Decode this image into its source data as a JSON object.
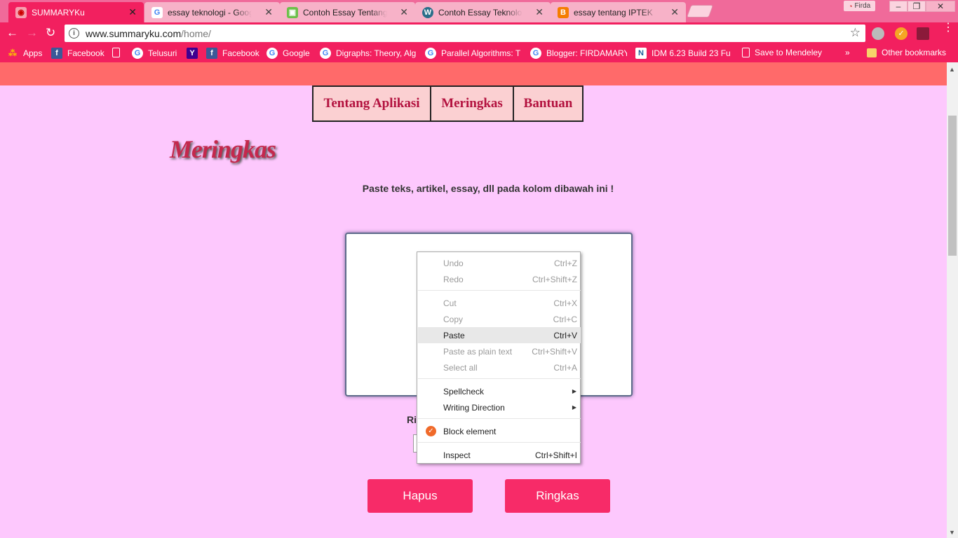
{
  "browser": {
    "user_name": "Firda",
    "tabs": [
      {
        "title": "SUMMARYKu",
        "active": true
      },
      {
        "title": "essay teknologi - Google",
        "active": false
      },
      {
        "title": "Contoh Essay Tentang Te",
        "active": false
      },
      {
        "title": "Contoh Essay Teknologi",
        "active": false
      },
      {
        "title": "essay tentang IPTEK",
        "active": false
      }
    ],
    "url_host": "www.summaryku.com",
    "url_path": "/home/",
    "bookmarks": [
      {
        "label": "Apps",
        "icon": "apps-grid-icon"
      },
      {
        "label": "Facebook",
        "icon": "facebook-icon"
      },
      {
        "label": "",
        "icon": "page-icon"
      },
      {
        "label": "Telusuri",
        "icon": "google-icon"
      },
      {
        "label": "",
        "icon": "yahoo-icon"
      },
      {
        "label": "Facebook",
        "icon": "facebook-icon"
      },
      {
        "label": "Google",
        "icon": "google-icon"
      },
      {
        "label": "Digraphs: Theory, Alg",
        "icon": "google-icon"
      },
      {
        "label": "Parallel Algorithms: T",
        "icon": "google-icon"
      },
      {
        "label": "Blogger: FIRDAMARY",
        "icon": "google-icon"
      },
      {
        "label": "IDM 6.23 Build 23 Fu",
        "icon": "n-icon"
      },
      {
        "label": "Save to Mendeley",
        "icon": "page-icon"
      }
    ],
    "bookmarks_more": "»",
    "other_bookmarks": "Other bookmarks"
  },
  "site": {
    "nav": [
      "Tentang Aplikasi",
      "Meringkas",
      "Bantuan"
    ],
    "heading": "Meringkas",
    "instruction": "Paste teks, artikel, essay, dll pada kolom dibawah ini !",
    "ratio_label": "Ri",
    "buttons": {
      "clear": "Hapus",
      "summarize": "Ringkas"
    }
  },
  "context_menu": {
    "items": [
      {
        "label": "Undo",
        "shortcut": "Ctrl+Z",
        "enabled": false
      },
      {
        "label": "Redo",
        "shortcut": "Ctrl+Shift+Z",
        "enabled": false
      },
      {
        "label": "Cut",
        "shortcut": "Ctrl+X",
        "enabled": false
      },
      {
        "label": "Copy",
        "shortcut": "Ctrl+C",
        "enabled": false
      },
      {
        "label": "Paste",
        "shortcut": "Ctrl+V",
        "enabled": true
      },
      {
        "label": "Paste as plain text",
        "shortcut": "Ctrl+Shift+V",
        "enabled": false
      },
      {
        "label": "Select all",
        "shortcut": "Ctrl+A",
        "enabled": false
      },
      {
        "label": "Spellcheck",
        "shortcut": "",
        "enabled": true
      },
      {
        "label": "Writing Direction",
        "shortcut": "",
        "enabled": true
      },
      {
        "label": "Block element",
        "shortcut": "",
        "enabled": true
      },
      {
        "label": "Inspect",
        "shortcut": "Ctrl+Shift+I",
        "enabled": true
      }
    ]
  },
  "colors": {
    "page_bg": "#fdc8fd",
    "browser_chrome": "#f2205f",
    "header_bar": "#ff6a6a",
    "button": "#f72b68",
    "nav_text": "#b3123f"
  }
}
